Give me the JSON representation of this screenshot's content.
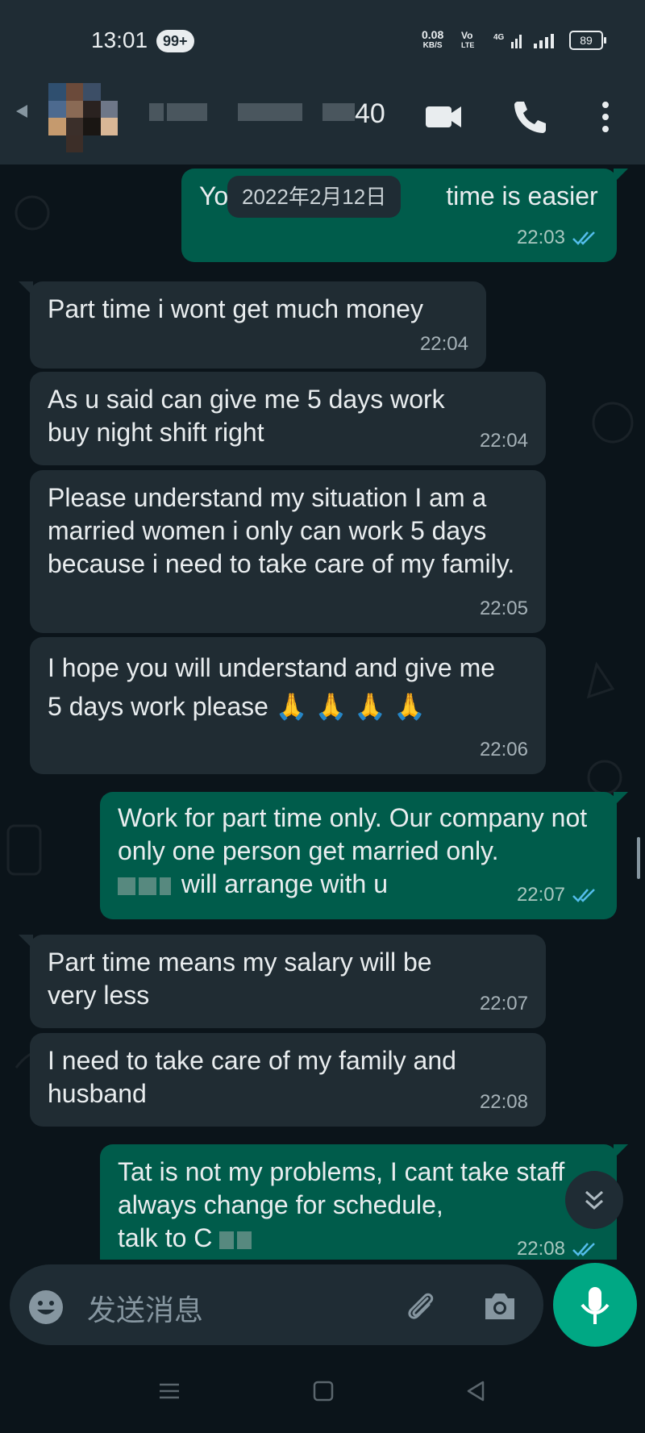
{
  "status_bar": {
    "time": "13:01",
    "notification_badge": "99+",
    "net_speed_value": "0.08",
    "net_speed_unit": "KB/S",
    "volte_top": "Vo",
    "volte_bottom": "LTE",
    "network": "4G",
    "battery": "89"
  },
  "header": {
    "contact_name_visible_suffix": "40",
    "icons": [
      "back-arrow-icon",
      "video-call-icon",
      "phone-icon",
      "more-icon"
    ]
  },
  "chat": {
    "date_pill": "2022年2月12日",
    "messages": [
      {
        "dir": "out",
        "text_prefix": "Yo",
        "text_suffix": "time is easier",
        "time": "22:03",
        "ticks": "read"
      },
      {
        "dir": "in",
        "text": "Part time i wont get much money",
        "time": "22:04"
      },
      {
        "dir": "in",
        "text": "As u said can give me 5 days work buy night shift right",
        "time": "22:04"
      },
      {
        "dir": "in",
        "text": "Please understand my situation I am a married women i only can work 5 days because i need to take care of my family.",
        "time": "22:05"
      },
      {
        "dir": "in",
        "text": "I hope you will understand and give me 5 days work please 🙏 🙏 🙏 🙏",
        "time": "22:06"
      },
      {
        "dir": "out",
        "text": "Work for part time only. Our company not only one person get married only.",
        "text_line3": "will arrange with u",
        "time": "22:07",
        "ticks": "read"
      },
      {
        "dir": "in",
        "text": "Part time means my salary will be very less",
        "time": "22:07"
      },
      {
        "dir": "in",
        "text": "I need to take care of my family and husband",
        "time": "22:08"
      },
      {
        "dir": "out",
        "text": "Tat is not my problems, I cant take staff always change for schedule,",
        "text_line3": "talk to C",
        "time": "22:08",
        "ticks": "read"
      }
    ]
  },
  "input": {
    "placeholder": "发送消息"
  },
  "colors": {
    "background": "#0b141a",
    "bar": "#1f2c34",
    "incoming": "#202c33",
    "outgoing": "#005c4b",
    "accent": "#00a884",
    "tick_read": "#53bdeb"
  }
}
